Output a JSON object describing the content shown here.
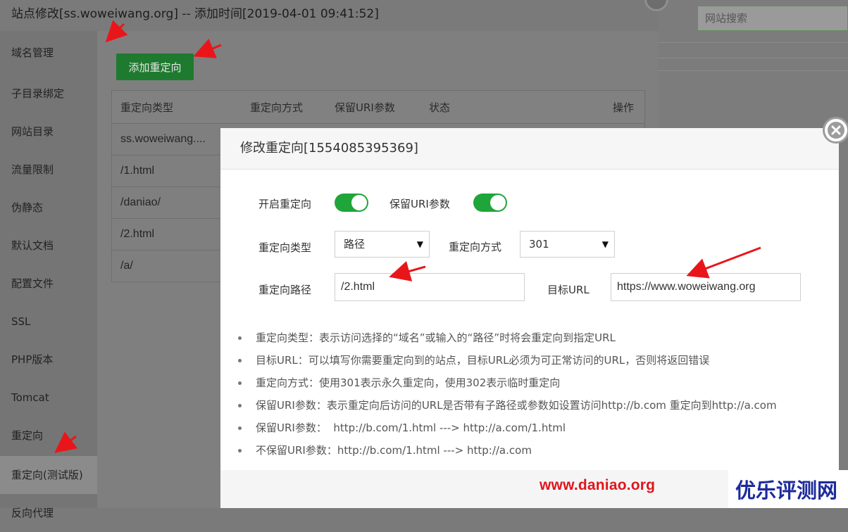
{
  "panel": {
    "title": "站点修改[ss.woweiwang.org] -- 添加时间[2019-04-01 09:41:52]",
    "sidebar": [
      {
        "label": "域名管理"
      },
      {
        "label": "子目录绑定"
      },
      {
        "label": "网站目录"
      },
      {
        "label": "流量限制"
      },
      {
        "label": "伪静态"
      },
      {
        "label": "默认文档"
      },
      {
        "label": "配置文件"
      },
      {
        "label": "SSL"
      },
      {
        "label": "PHP版本"
      },
      {
        "label": "Tomcat"
      },
      {
        "label": "重定向"
      },
      {
        "label": "重定向(测试版)"
      },
      {
        "label": "反向代理"
      }
    ],
    "add_button": "添加重定向",
    "table": {
      "headers": [
        "重定向类型",
        "重定向方式",
        "保留URI参数",
        "状态",
        "操作"
      ],
      "rows": [
        "ss.woweiwang....",
        "/1.html",
        "/daniao/",
        "/2.html",
        "/a/"
      ]
    }
  },
  "background": {
    "search_placeholder": "网站搜索"
  },
  "modal": {
    "title": "修改重定向[1554085395369]",
    "enable_label": "开启重定向",
    "keep_uri_label": "保留URI参数",
    "enable_on": true,
    "keep_uri_on": true,
    "type_label": "重定向类型",
    "type_value": "路径",
    "method_label": "重定向方式",
    "method_value": "301",
    "path_label": "重定向路径",
    "path_value": "/2.html",
    "target_label": "目标URL",
    "target_value": "https://www.woweiwang.org",
    "tips": [
      "重定向类型：表示访问选择的“域名”或输入的“路径”时将会重定向到指定URL",
      "目标URL：可以填写你需要重定向到的站点，目标URL必须为可正常访问的URL，否则将返回错误",
      "重定向方式：使用301表示永久重定向，使用302表示临时重定向",
      "保留URI参数：表示重定向后访问的URL是否带有子路径或参数如设置访问http://b.com 重定向到http://a.com",
      "保留URI参数：  http://b.com/1.html ---> http://a.com/1.html",
      "不保留URI参数：http://b.com/1.html ---> http://a.com"
    ]
  },
  "colors": {
    "toggle_on": "#20a53a",
    "add_button": "#1e7a2e",
    "annotation_arrow": "#e8161b"
  },
  "watermarks": {
    "url": "www.daniao.org",
    "site": "优乐评测网"
  }
}
